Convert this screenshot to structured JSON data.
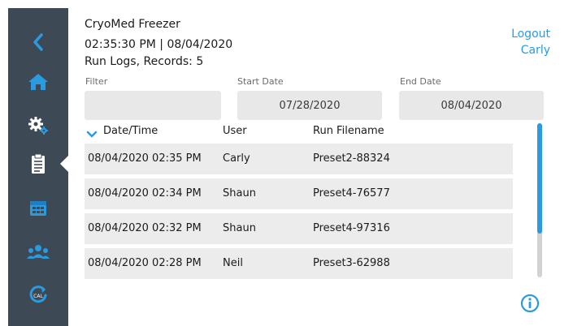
{
  "header": {
    "title": "CryoMed Freezer",
    "datetime": "02:35:30 PM | 08/04/2020",
    "subtitle": "Run Logs, Records: 5"
  },
  "account": {
    "logout_label": "Logout",
    "user_name": "Carly"
  },
  "sidebar": {
    "items": [
      {
        "icon": "back-chevron-icon"
      },
      {
        "icon": "home-icon"
      },
      {
        "icon": "gears-icon"
      },
      {
        "icon": "clipboard-icon",
        "active": true
      },
      {
        "icon": "calendar-icon"
      },
      {
        "icon": "users-icon"
      },
      {
        "icon": "calibration-icon",
        "label": "CAL"
      }
    ]
  },
  "filters": {
    "filter_label": "Filter",
    "filter_value": "",
    "start_label": "Start Date",
    "start_value": "07/28/2020",
    "end_label": "End Date",
    "end_value": "08/04/2020"
  },
  "table": {
    "columns": [
      "Date/Time",
      "User",
      "Run Filename"
    ],
    "rows": [
      {
        "datetime": "08/04/2020 02:35 PM",
        "user": "Carly",
        "file": "Preset2-88324"
      },
      {
        "datetime": "08/04/2020 02:34 PM",
        "user": "Shaun",
        "file": "Preset4-76577"
      },
      {
        "datetime": "08/04/2020 02:32 PM",
        "user": "Shaun",
        "file": "Preset4-97316"
      },
      {
        "datetime": "08/04/2020 02:28 PM",
        "user": "Neil",
        "file": "Preset3-62988"
      }
    ]
  },
  "colors": {
    "sidebar": "#3d4a56",
    "accent": "#2a9be0",
    "row_bg": "#ececec",
    "field_bg": "#e8e8e8"
  }
}
